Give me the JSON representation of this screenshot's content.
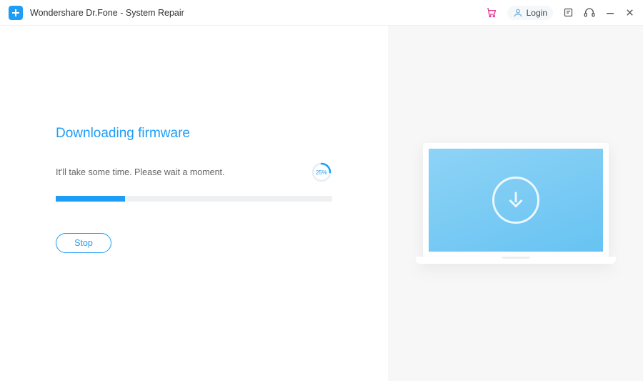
{
  "app": {
    "title": "Wondershare Dr.Fone - System Repair"
  },
  "titlebar": {
    "login_label": "Login"
  },
  "main": {
    "heading": "Downloading firmware",
    "status_text": "It'll take some time. Please wait a moment.",
    "progress_percent": 25,
    "progress_percent_label": "25%",
    "stop_label": "Stop"
  },
  "colors": {
    "accent": "#1e9df7",
    "cart_accent": "#e8368f"
  }
}
